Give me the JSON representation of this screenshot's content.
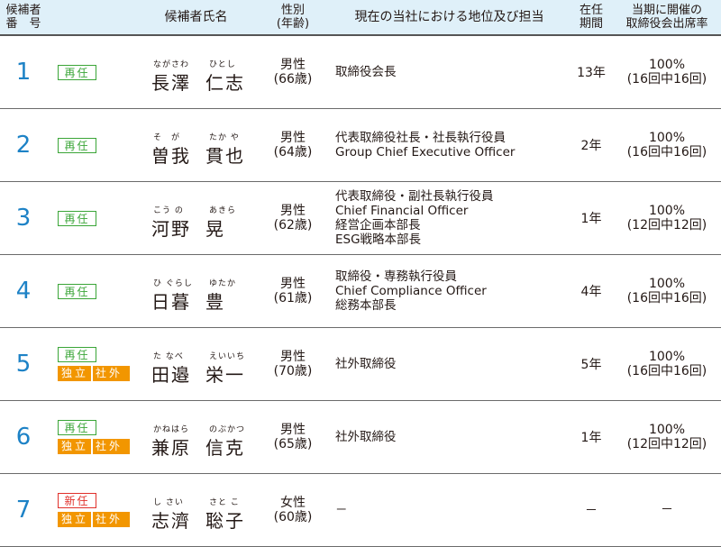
{
  "header": {
    "no": [
      "候補者",
      "番　号"
    ],
    "name": "候補者氏名",
    "gender": [
      "性別",
      "(年齢)"
    ],
    "position": "現在の当社における地位及び担当",
    "term": [
      "在任",
      "期間"
    ],
    "attendance": [
      "当期に開催の",
      "取締役会出席率"
    ]
  },
  "badge_labels": {
    "reappointed": "再任",
    "new": "新任",
    "independent": "独立",
    "outside": "社外"
  },
  "rows": [
    {
      "no": "1",
      "status": "再任",
      "independent": false,
      "family_ruby": "ながさわ",
      "given_ruby": "ひとし",
      "family": "長澤",
      "given": "仁志",
      "gender": "男性",
      "age": "(66歳)",
      "position": [
        "取締役会長"
      ],
      "term": "13年",
      "attendance": [
        "100%",
        "(16回中16回)"
      ]
    },
    {
      "no": "2",
      "status": "再任",
      "independent": false,
      "family_ruby": "そ　が",
      "given_ruby": "たか や",
      "family": "曽我",
      "given": "貫也",
      "gender": "男性",
      "age": "(64歳)",
      "position": [
        "代表取締役社長・社長執行役員",
        "Group Chief Executive Officer"
      ],
      "term": "2年",
      "attendance": [
        "100%",
        "(16回中16回)"
      ]
    },
    {
      "no": "3",
      "status": "再任",
      "independent": false,
      "family_ruby": "こう の",
      "given_ruby": "あきら",
      "family": "河野",
      "given": "晃",
      "gender": "男性",
      "age": "(62歳)",
      "position": [
        "代表取締役・副社長執行役員",
        "Chief Financial Officer",
        "経営企画本部長",
        "ESG戦略本部長"
      ],
      "term": "1年",
      "attendance": [
        "100%",
        "(12回中12回)"
      ]
    },
    {
      "no": "4",
      "status": "再任",
      "independent": false,
      "family_ruby": "ひ ぐらし",
      "given_ruby": "ゆたか",
      "family": "日暮",
      "given": "豊",
      "gender": "男性",
      "age": "(61歳)",
      "position": [
        "取締役・専務執行役員",
        "Chief Compliance Officer",
        "総務本部長"
      ],
      "term": "4年",
      "attendance": [
        "100%",
        "(16回中16回)"
      ]
    },
    {
      "no": "5",
      "status": "再任",
      "independent": true,
      "family_ruby": "た なべ",
      "given_ruby": "えいいち",
      "family": "田邉",
      "given": "栄一",
      "gender": "男性",
      "age": "(70歳)",
      "position": [
        "社外取締役"
      ],
      "term": "5年",
      "attendance": [
        "100%",
        "(16回中16回)"
      ]
    },
    {
      "no": "6",
      "status": "再任",
      "independent": true,
      "family_ruby": "かねはら",
      "given_ruby": "のぶかつ",
      "family": "兼原",
      "given": "信克",
      "gender": "男性",
      "age": "(65歳)",
      "position": [
        "社外取締役"
      ],
      "term": "1年",
      "attendance": [
        "100%",
        "(12回中12回)"
      ]
    },
    {
      "no": "7",
      "status": "新任",
      "independent": true,
      "family_ruby": "し さい",
      "given_ruby": "さと こ",
      "family": "志濟",
      "given": "聡子",
      "gender": "女性",
      "age": "(60歳)",
      "position": [
        "－"
      ],
      "term": "－",
      "attendance": [
        "－"
      ]
    }
  ]
}
